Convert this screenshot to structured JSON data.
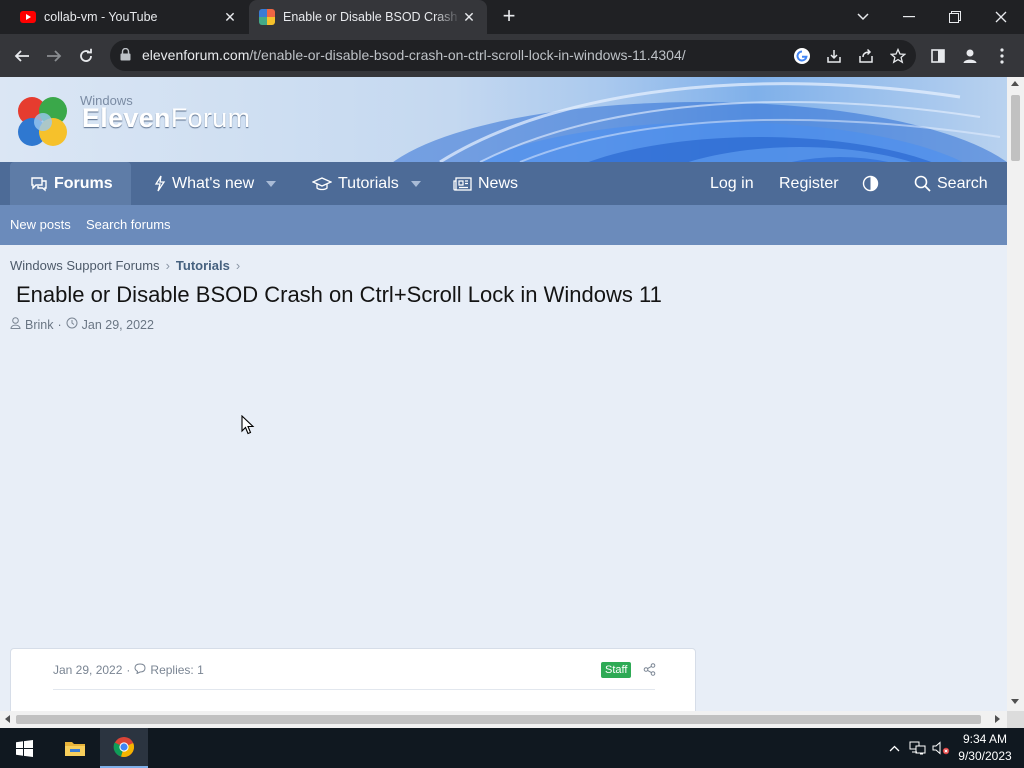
{
  "browser": {
    "tabs": [
      {
        "title": "collab-vm - YouTube",
        "active": false
      },
      {
        "title": "Enable or Disable BSOD Crash on Ctrl+Scroll Lock in Windows 11",
        "active": true
      }
    ],
    "url_host": "elevenforum.com",
    "url_path": "/t/enable-or-disable-bsod-crash-on-ctrl-scroll-lock-in-windows-11.4304/"
  },
  "site": {
    "brand_small": "Windows",
    "brand_bold": "Eleven",
    "brand_thin": "Forum",
    "nav": {
      "forums": "Forums",
      "whats_new": "What's new",
      "tutorials": "Tutorials",
      "news": "News",
      "login": "Log in",
      "register": "Register",
      "search": "Search"
    },
    "subnav": {
      "new_posts": "New posts",
      "search_forums": "Search forums"
    }
  },
  "thread": {
    "breadcrumb": [
      "Windows Support Forums",
      "Tutorials"
    ],
    "title": "Enable or Disable BSOD Crash on Ctrl+Scroll Lock in Windows 11",
    "author": "Brink",
    "date": "Jan 29, 2022",
    "post_date": "Jan 29, 2022",
    "replies": "Replies: 1",
    "badge": "Staff"
  },
  "taskbar": {
    "time": "9:34 AM",
    "date": "9/30/2023"
  },
  "colors": {
    "nav_bg": "#4d6b97",
    "subnav_bg": "#6b8bbb",
    "staff_badge": "#2eaa55",
    "page_bg": "#e8eef7"
  }
}
